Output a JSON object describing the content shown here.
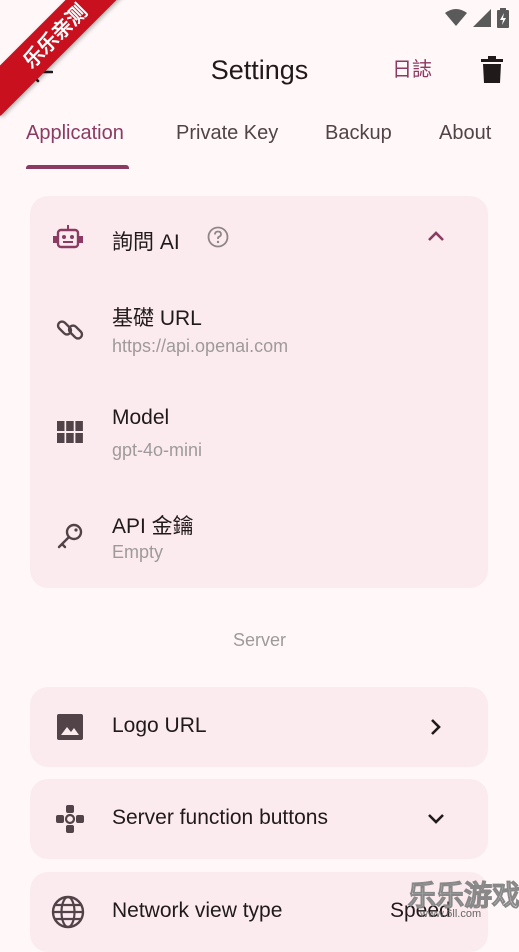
{
  "watermark": {
    "corner_text": "乐乐亲测",
    "bottom_text": "乐乐游戏",
    "bottom_url": "www.6ll.com"
  },
  "app_bar": {
    "title": "Settings",
    "log_label": "日誌"
  },
  "tabs": [
    {
      "label": "Application",
      "active": true
    },
    {
      "label": "Private Key",
      "active": false
    },
    {
      "label": "Backup",
      "active": false
    },
    {
      "label": "About",
      "active": false
    }
  ],
  "ai_card": {
    "header": {
      "label": "詢問 AI",
      "icon": "robot-icon",
      "help_icon": "help-circle-icon",
      "expanded": true
    },
    "rows": [
      {
        "title": "基礎 URL",
        "subtitle": "https://api.openai.com",
        "icon": "link-icon"
      },
      {
        "title": "Model",
        "subtitle": "gpt-4o-mini",
        "icon": "grid-icon"
      },
      {
        "title": "API 金鑰",
        "subtitle": "Empty",
        "icon": "key-icon"
      }
    ]
  },
  "server_section": {
    "label": "Server",
    "items": [
      {
        "title": "Logo URL",
        "icon": "image-icon",
        "trailing": "chevron-right-icon"
      },
      {
        "title": "Server function buttons",
        "icon": "apps-icon",
        "trailing": "chevron-down-icon"
      },
      {
        "title": "Network view type",
        "icon": "globe-icon",
        "trailing_value": "Speed"
      }
    ]
  },
  "colors": {
    "primary": "#8B3A62",
    "background": "#FFF7F8",
    "card": "#FCEBEE",
    "muted_text": "#9E9A9B"
  }
}
